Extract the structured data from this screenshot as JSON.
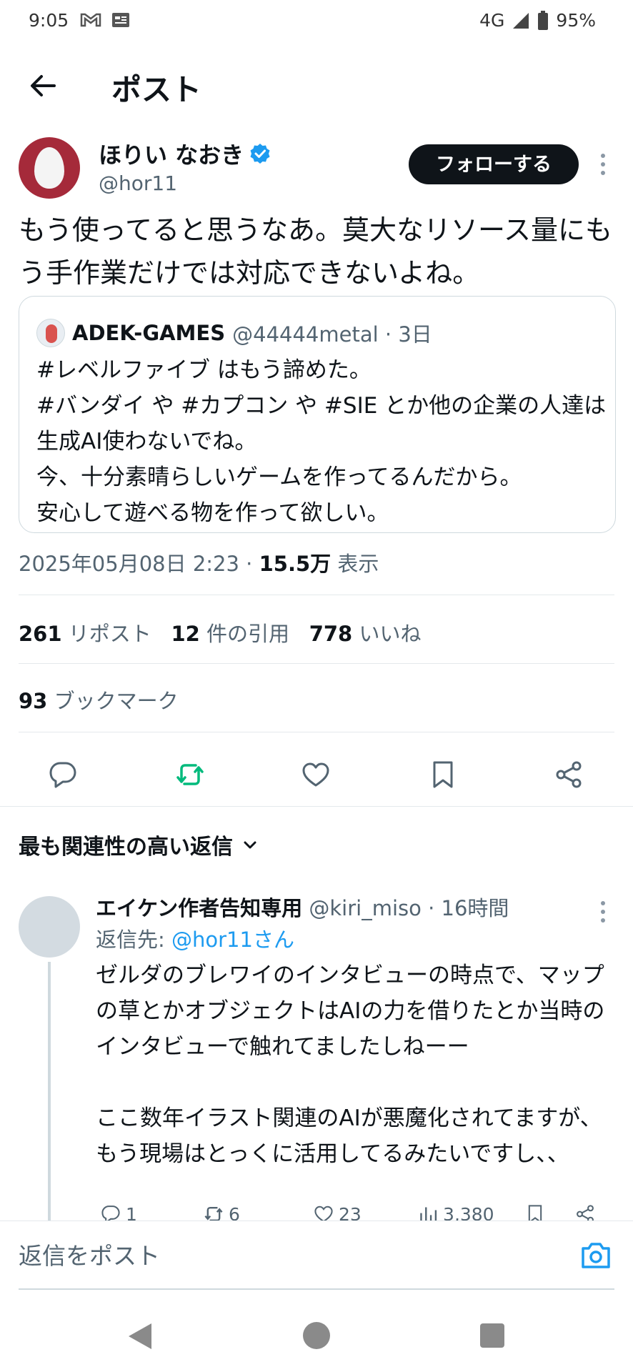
{
  "status_bar": {
    "time": "9:05",
    "network": "4G",
    "battery": "95%"
  },
  "header": {
    "title": "ポスト"
  },
  "post": {
    "author_name": "ほりい なおき",
    "author_handle": "@hor11",
    "follow_label": "フォローする",
    "text": "もう使ってると思うなあ。莫大なリソース量にもう手作業だけでは対応できないよね。",
    "quote": {
      "name": "ADEK-GAMES",
      "meta": "@44444metal · 3日",
      "lines": [
        "#レベルファイブ はもう諦めた。",
        "#バンダイ や #カプコン や #SIE とか他の企業の人達は生成AI使わないでね。",
        "今、十分素晴らしいゲームを作ってるんだから。",
        "安心して遊べる物を作って欲しい。"
      ]
    },
    "timestamp": "2025年05月08日 2:23 · ",
    "views_count": "15.5万",
    "views_label": " 表示",
    "reposts_count": "261",
    "reposts_label": "リポスト",
    "quotes_count": "12",
    "quotes_label": "件の引用",
    "likes_count": "778",
    "likes_label": "いいね",
    "bookmarks_count": "93",
    "bookmarks_label": "ブックマーク"
  },
  "sort": {
    "label": "最も関連性の高い返信"
  },
  "reply": {
    "name": "エイケン作者告知専用",
    "meta": " @kiri_miso · 16時間",
    "reply_to_prefix": "返信先: ",
    "reply_to_handle": "@hor11さん",
    "body": "ゼルダのブレワイのインタビューの時点で、マップの草とかオブジェクトはAIの力を借りたとか当時のインタビューで触れてましたしねーー\n\nここ数年イラスト関連のAIが悪魔化されてますが、もう現場はとっくに活用してるみたいですし、、",
    "replies": "1",
    "reposts": "6",
    "likes": "23",
    "views": "3,380"
  },
  "compose": {
    "placeholder": "返信をポスト"
  },
  "colors": {
    "accent": "#1d9bf0",
    "repost_green": "#00ba7c",
    "text": "#0f1419",
    "muted": "#536471"
  },
  "icons": [
    "back-arrow-icon",
    "verified-badge-icon",
    "more-icon",
    "reply-icon",
    "repost-icon",
    "like-icon",
    "bookmark-icon",
    "share-icon",
    "chevron-down-icon",
    "camera-icon",
    "views-icon"
  ]
}
